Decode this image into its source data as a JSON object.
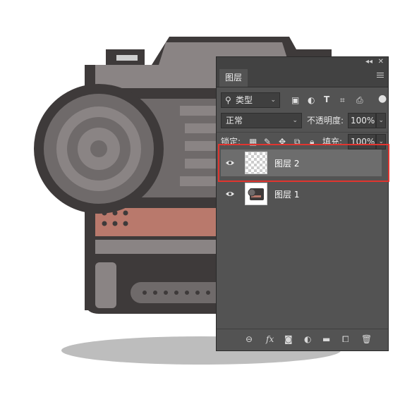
{
  "panel": {
    "tab_label": "图层",
    "filter": {
      "label": "类型"
    },
    "blend_mode": "正常",
    "opacity_label": "不透明度:",
    "opacity_value": "100%",
    "lock_label": "锁定:",
    "fill_label": "填充:",
    "fill_value": "100%",
    "layers": [
      {
        "name": "图层 2",
        "selected": true,
        "visible": true,
        "thumbnail": "transparent-checker"
      },
      {
        "name": "图层 1",
        "selected": false,
        "visible": true,
        "thumbnail": "camera-artwork"
      }
    ]
  },
  "icons": {
    "filter": [
      "search-icon",
      "image-filter-icon",
      "adjustment-filter-icon",
      "type-filter-icon",
      "shape-filter-icon",
      "smart-object-filter-icon",
      "filter-toggle-icon"
    ],
    "lock": [
      "lock-transparent-icon",
      "lock-paint-icon",
      "lock-position-icon",
      "lock-artboard-icon",
      "lock-all-icon"
    ],
    "footer": [
      "link-layers-icon",
      "fx-icon",
      "add-mask-icon",
      "adjustment-layer-icon",
      "new-group-icon",
      "new-layer-icon",
      "delete-layer-icon"
    ]
  },
  "colors": {
    "panel_bg": "#535353",
    "selected_row": "#6d6d6d",
    "highlight": "#e1352f",
    "camera_dark": "#3e3a3a",
    "camera_mid": "#8a8484",
    "camera_accent": "#b9796c"
  }
}
